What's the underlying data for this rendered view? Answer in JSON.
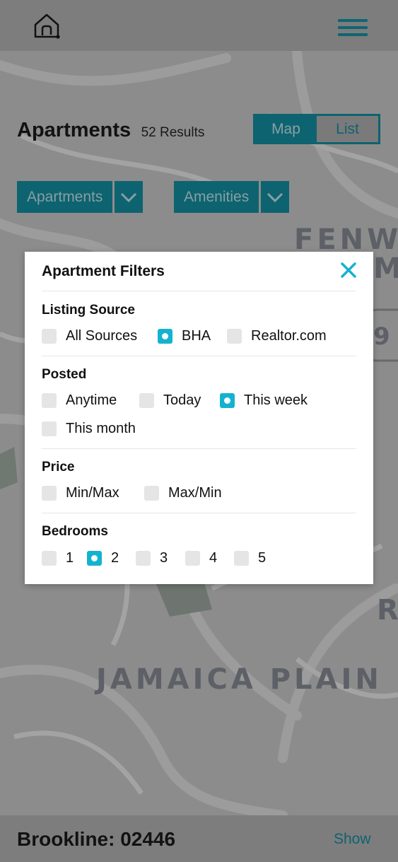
{
  "header": {
    "home_icon": "home-icon",
    "menu_icon": "hamburger-menu-icon"
  },
  "listing": {
    "title": "Apartments",
    "results": "52 Results"
  },
  "view_toggle": {
    "map_label": "Map",
    "list_label": "List",
    "selected": "Map"
  },
  "filters_bar": {
    "type_label": "Apartments",
    "amenities_label": "Amenities"
  },
  "map": {
    "labels": [
      "FENWA",
      "MO",
      "R",
      "JAMAICA PLAIN",
      "9"
    ]
  },
  "filter_modal": {
    "title": "Apartment Filters",
    "close_icon": "close-icon",
    "sections": {
      "source": {
        "title": "Listing Source",
        "options": [
          {
            "label": "All Sources",
            "checked": false
          },
          {
            "label": "BHA",
            "checked": true
          },
          {
            "label": "Realtor.com",
            "checked": false
          }
        ]
      },
      "posted": {
        "title": "Posted",
        "options": [
          {
            "label": "Anytime",
            "checked": false
          },
          {
            "label": "Today",
            "checked": false
          },
          {
            "label": "This week",
            "checked": true
          },
          {
            "label": "This month",
            "checked": false
          }
        ]
      },
      "price": {
        "title": "Price",
        "options": [
          {
            "label": "Min/Max",
            "checked": false
          },
          {
            "label": "Max/Min",
            "checked": false
          }
        ]
      },
      "bedrooms": {
        "title": "Bedrooms",
        "options": [
          {
            "label": "1",
            "checked": false
          },
          {
            "label": "2",
            "checked": true
          },
          {
            "label": "3",
            "checked": false
          },
          {
            "label": "4",
            "checked": false
          },
          {
            "label": "5",
            "checked": false
          }
        ]
      }
    }
  },
  "footer": {
    "location": "Brookline: 02446",
    "show_label": "Show"
  },
  "colors": {
    "accent": "#13b3cf",
    "brand": "#0e6370",
    "overlay": "#7a7a7a"
  }
}
